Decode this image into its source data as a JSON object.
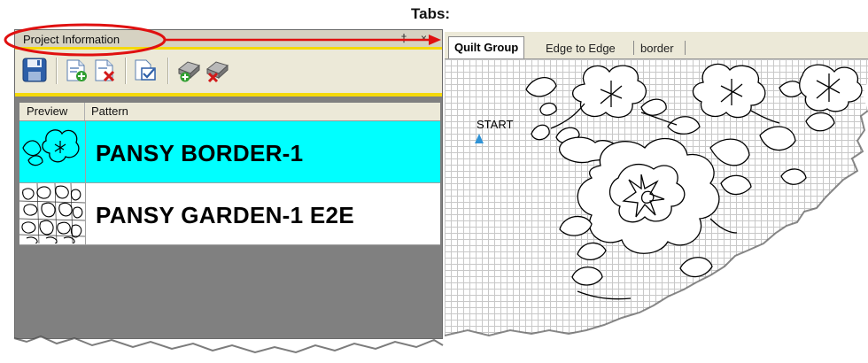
{
  "annotation": {
    "tabs_caption": "Tabs:"
  },
  "left_panel": {
    "title": "Project Information",
    "pin_glyph": "†",
    "close_glyph": "×",
    "toolbar": {
      "buttons": [
        {
          "icon": "save-icon"
        },
        {
          "icon": "new-pattern-add-icon"
        },
        {
          "icon": "delete-pattern-icon"
        },
        {
          "icon": "check-pattern-icon"
        },
        {
          "icon": "add-group-icon"
        },
        {
          "icon": "delete-group-icon"
        }
      ]
    },
    "grid": {
      "columns": [
        "Preview",
        "Pattern"
      ],
      "rows": [
        {
          "pattern": "PANSY BORDER-1",
          "selected": true
        },
        {
          "pattern": "PANSY GARDEN-1 E2E",
          "selected": false
        }
      ]
    }
  },
  "right_panel": {
    "tabs": [
      {
        "label": "Quilt Group",
        "active": true
      },
      {
        "label": "Edge to Edge",
        "active": false
      },
      {
        "label": "border",
        "active": false
      }
    ],
    "canvas": {
      "start_label": "START"
    }
  },
  "colors": {
    "selected_row": "#00ffff",
    "panel_accent": "#f5d90a",
    "annotation_red": "#e01010",
    "start_marker": "#2f93d6"
  }
}
